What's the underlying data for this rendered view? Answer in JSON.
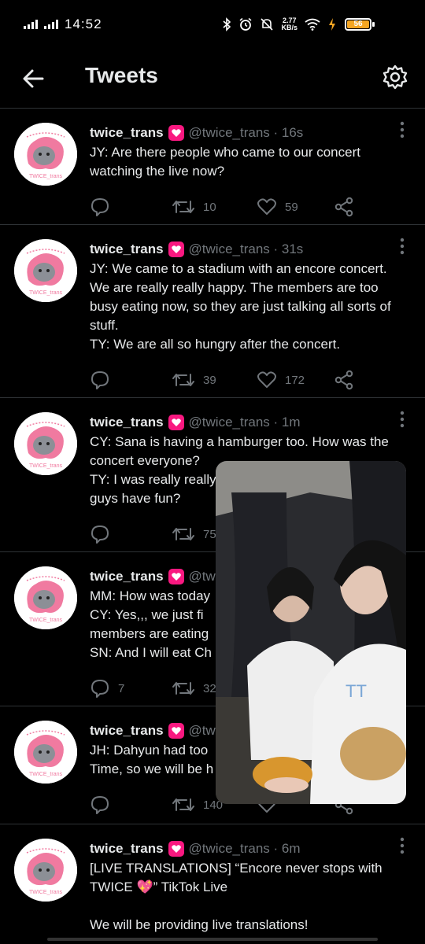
{
  "status_bar": {
    "time": "14:52",
    "net_speed_top": "2.77",
    "net_speed_bottom": "KB/s",
    "battery": "56"
  },
  "header": {
    "title": "Tweets"
  },
  "tweets": [
    {
      "name": "twice_trans",
      "handle": "@twice_trans · 16s",
      "text": "JY: Are there people who came to our concert watching the live now?",
      "replies": "",
      "retweets": "10",
      "likes": "59"
    },
    {
      "name": "twice_trans",
      "handle": "@twice_trans · 31s",
      "text": "JY: We came to a stadium with an encore concert. We are really really happy. The members are too busy eating now, so they are just talking all sorts of stuff.\nTY: We are all so hungry after the concert.",
      "replies": "",
      "retweets": "39",
      "likes": "172"
    },
    {
      "name": "twice_trans",
      "handle": "@twice_trans · 1m",
      "text": "CY: Sana is having a hamburger too. How was the concert everyone?\nTY: I was really really\nguys have fun?",
      "replies": "",
      "retweets": "75",
      "likes": ""
    },
    {
      "name": "twice_trans",
      "handle": "@tw",
      "text": "MM: How was today\nCY: Yes,,, we just fi\nmembers are eating\nSN: And I will eat Ch",
      "replies": "7",
      "retweets": "32",
      "likes": ""
    },
    {
      "name": "twice_trans",
      "handle": "@tw",
      "text": "JH: Dahyun had too\nTime, so we will be h",
      "replies": "",
      "retweets": "140",
      "likes": ""
    },
    {
      "name": "twice_trans",
      "handle": "@twice_trans · 6m",
      "text": "[LIVE TRANSLATIONS] “Encore never stops with TWICE 💖” TikTok Live\n\nWe will be providing live translations!",
      "replies": "",
      "retweets": "",
      "likes": ""
    }
  ],
  "avatar_label": "TWICE_trans",
  "colors": {
    "background": "#000000",
    "divider": "#2f3336",
    "muted": "#71767b",
    "badge": "#f91880"
  }
}
